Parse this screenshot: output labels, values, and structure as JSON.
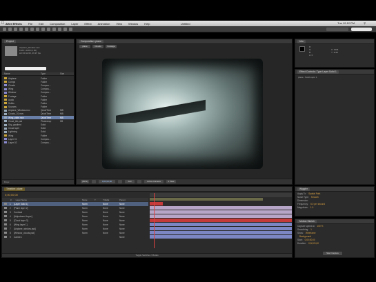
{
  "menubar": {
    "app": "After Effects",
    "items": [
      "File",
      "Edit",
      "Composition",
      "Layer",
      "Effect",
      "Animation",
      "View",
      "Window",
      "Help"
    ],
    "clock": "Tue 12:12 PM",
    "doc_title": "Untitled"
  },
  "toolbar": {
    "workspace": "Workspace:",
    "search_placeholder": "Search Help"
  },
  "project": {
    "tab": "Project",
    "thumb_info": [
      "Airplane_Window.mov",
      "1920 x 1080 (1.00)",
      "Δ 0:00:12:00, 29.97 fps"
    ],
    "columns": [
      "Name",
      "Type",
      "Size"
    ],
    "items": [
      {
        "name": "Airplane",
        "type": "Folder",
        "size": "",
        "sel": false
      },
      {
        "name": "Comps",
        "type": "Folder",
        "size": "",
        "sel": false
      },
      {
        "name": "Clouds",
        "type": "Compos...",
        "size": "",
        "sel": false
      },
      {
        "name": "Wing",
        "type": "Compos...",
        "size": "",
        "sel": false
      },
      {
        "name": "Window",
        "type": "Compos...",
        "size": "",
        "sel": false
      },
      {
        "name": "Footage",
        "type": "Folder",
        "size": "",
        "sel": false
      },
      {
        "name": "Audio",
        "type": "Folder",
        "size": "",
        "sel": false
      },
      {
        "name": "Solids",
        "type": "Folder",
        "size": "",
        "sel": false
      },
      {
        "name": "Sources",
        "type": "Folder",
        "size": "",
        "sel": false
      },
      {
        "name": "Airplane_Window.mov",
        "type": "QuickTime",
        "size": "MB",
        "sel": false
      },
      {
        "name": "Clouds_01.mov",
        "type": "QuickTime",
        "size": "MB",
        "sel": false
      },
      {
        "name": "Wing_plate.mov",
        "type": "QuickTime",
        "size": "MB",
        "sel": true
      },
      {
        "name": "Cloud_tile.psd",
        "type": "Photoshop",
        "size": "KB",
        "sel": false
      },
      {
        "name": "Sky_gradient",
        "type": "Solid",
        "size": "",
        "sel": false
      },
      {
        "name": "Cloud layer",
        "type": "Solid",
        "size": "",
        "sel": false
      },
      {
        "name": "Lightning",
        "type": "Solid",
        "size": "",
        "sel": false
      },
      {
        "name": "Wing",
        "type": "Folder",
        "size": "",
        "sel": false
      },
      {
        "name": "Layer 01",
        "type": "Compos...",
        "size": "",
        "sel": false
      },
      {
        "name": "Layer 02",
        "type": "Compos...",
        "size": "",
        "sel": false
      }
    ],
    "footer_bpc": "8 bpc"
  },
  "composition": {
    "tab": "Composition: plane",
    "sub_tabs": [
      "plane",
      "Clouds",
      "Footage"
    ],
    "zoom": "(50%)",
    "timecode": "0;00;00;00",
    "resolution": "Full",
    "camera": "Active Camera",
    "view": "1 View"
  },
  "info": {
    "tab": "Info",
    "values": [
      "R:",
      "G:",
      "B:",
      "A: 0",
      "X: 1536",
      "Y: 1134"
    ]
  },
  "effect_controls": {
    "tab": "Effect Controls: Type Layer Solid 1",
    "layer": "plane • Solid Layer 1"
  },
  "timeline": {
    "tab": "Timeline: plane",
    "timecode": "0;00;00;00",
    "columns": [
      "#",
      "Layer Name",
      "Mode",
      "T",
      "TrkMat",
      "Parent"
    ],
    "layers": [
      {
        "num": "1",
        "name": "[Layer Solid 1]",
        "mode": "Norm",
        "trk": "None",
        "parent": "None",
        "sel": true,
        "color": "#c43a3a",
        "start": 0,
        "end": 0.09
      },
      {
        "num": "2",
        "name": "[Plane layer 2]",
        "mode": "Norm",
        "trk": "None",
        "parent": "None",
        "sel": false,
        "color": "#b7a5c7",
        "start": 0,
        "end": 1
      },
      {
        "num": "3",
        "name": "Contrast",
        "mode": "Norm",
        "trk": "None",
        "parent": "None",
        "sel": false,
        "color": "#b7a5c7",
        "start": 0,
        "end": 1
      },
      {
        "num": "4",
        "name": "[Adjustment Layer]",
        "mode": "Norm",
        "trk": "None",
        "parent": "None",
        "sel": false,
        "color": "#b7a5c7",
        "start": 0,
        "end": 1
      },
      {
        "num": "5",
        "name": "[Cloud layer 3]",
        "mode": "Norm",
        "trk": "None",
        "parent": "None",
        "sel": false,
        "color": "#c43a3a",
        "start": 0,
        "end": 1
      },
      {
        "num": "6",
        "name": "[Wing layer 1]",
        "mode": "Norm",
        "trk": "None",
        "parent": "None",
        "sel": false,
        "color": "#7d86c4",
        "start": 0,
        "end": 1
      },
      {
        "num": "7",
        "name": "[Airplane_window.psd]",
        "mode": "Norm",
        "trk": "None",
        "parent": "None",
        "sel": false,
        "color": "#7d86c4",
        "start": 0,
        "end": 1
      },
      {
        "num": "8",
        "name": "[Window_clouds.psd]",
        "mode": "Norm",
        "trk": "None",
        "parent": "None",
        "sel": false,
        "color": "#7d86c4",
        "start": 0,
        "end": 1
      },
      {
        "num": "9",
        "name": "Camera",
        "mode": "",
        "trk": "",
        "parent": "None",
        "sel": false,
        "color": "#7d86c4",
        "start": 0,
        "end": 1
      }
    ],
    "footer": "Toggle Switches / Modes"
  },
  "wiggler": {
    "tab": "Wiggler",
    "rows": [
      {
        "label": "Apply To:",
        "value": "Spatial Path"
      },
      {
        "label": "Noise Type:",
        "value": "Smooth"
      },
      {
        "label": "Dimension:",
        "value": ""
      },
      {
        "label": "Frequency:",
        "value": "5.0 per second"
      },
      {
        "label": "Magnitude:",
        "value": "1.0"
      }
    ]
  },
  "motion_sketch": {
    "tab": "Motion Sketch",
    "rows": [
      {
        "label": "Capture speed at:",
        "value": "100 %"
      },
      {
        "label": "Smoothing:",
        "value": "1"
      },
      {
        "label": "Show:",
        "value": "Wireframe"
      },
      {
        "label": "",
        "value": "Background"
      },
      {
        "label": "Start:",
        "value": "0;00;00;00"
      },
      {
        "label": "Duration:",
        "value": "0;00;20;00"
      }
    ],
    "button": "Start Capture"
  }
}
